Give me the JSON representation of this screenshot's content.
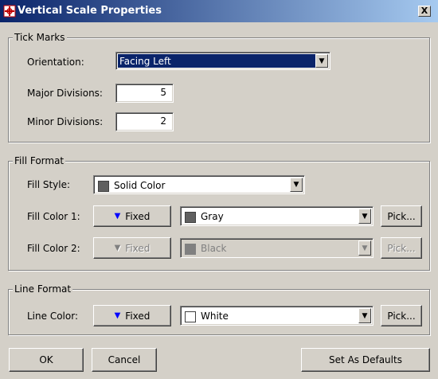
{
  "window": {
    "title": "Vertical Scale Properties",
    "close_label": "X",
    "icon": "properties-icon"
  },
  "tick_marks": {
    "legend": "Tick Marks",
    "orientation_label": "Orientation:",
    "orientation_value": "Facing Left",
    "major_label": "Major Divisions:",
    "major_value": "5",
    "minor_label": "Minor Divisions:",
    "minor_value": "2"
  },
  "fill_format": {
    "legend": "Fill Format",
    "style_label": "Fill Style:",
    "style_value": "Solid Color",
    "style_swatch_color": "#606060",
    "color1_label": "Fill Color 1:",
    "color1_mode": "Fixed",
    "color1_value": "Gray",
    "color1_swatch": "#606060",
    "color1_pick": "Pick...",
    "color2_label": "Fill Color 2:",
    "color2_mode": "Fixed",
    "color2_value": "Black",
    "color2_swatch": "#808080",
    "color2_pick": "Pick..."
  },
  "line_format": {
    "legend": "Line Format",
    "color_label": "Line Color:",
    "color_mode": "Fixed",
    "color_value": "White",
    "color_swatch": "#ffffff",
    "pick": "Pick..."
  },
  "buttons": {
    "ok": "OK",
    "cancel": "Cancel",
    "set_defaults": "Set As Defaults"
  },
  "colors": {
    "accent_arrow": "#0000ff",
    "titlebar_start": "#0a246a",
    "selection": "#0a246a"
  }
}
